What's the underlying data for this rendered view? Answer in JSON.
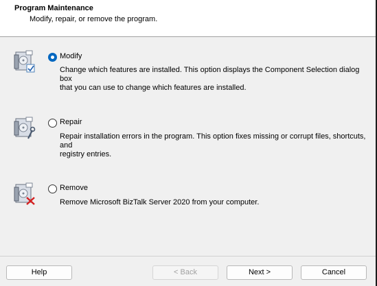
{
  "header": {
    "title": "Program Maintenance",
    "subtitle": "Modify, repair, or remove the program."
  },
  "options": [
    {
      "label": "Modify",
      "selected": true,
      "description_lines": [
        "Change which features are installed. This option displays the Component Selection dialog box",
        "that you can use to change which features are installed."
      ],
      "icon": "modify-icon"
    },
    {
      "label": "Repair",
      "selected": false,
      "description_lines": [
        "Repair installation errors in the program. This option fixes missing or corrupt files, shortcuts, and",
        "registry entries."
      ],
      "icon": "repair-icon"
    },
    {
      "label": "Remove",
      "selected": false,
      "description_lines": [
        "Remove Microsoft BizTalk Server 2020 from your computer."
      ],
      "icon": "remove-icon"
    }
  ],
  "buttons": {
    "help": "Help",
    "back": "< Back",
    "next": "Next >",
    "cancel": "Cancel"
  },
  "colors": {
    "accent": "#0067c0",
    "header_bg": "#ffffff",
    "body_bg": "#f0f0f0",
    "remove_mark": "#d42020"
  }
}
